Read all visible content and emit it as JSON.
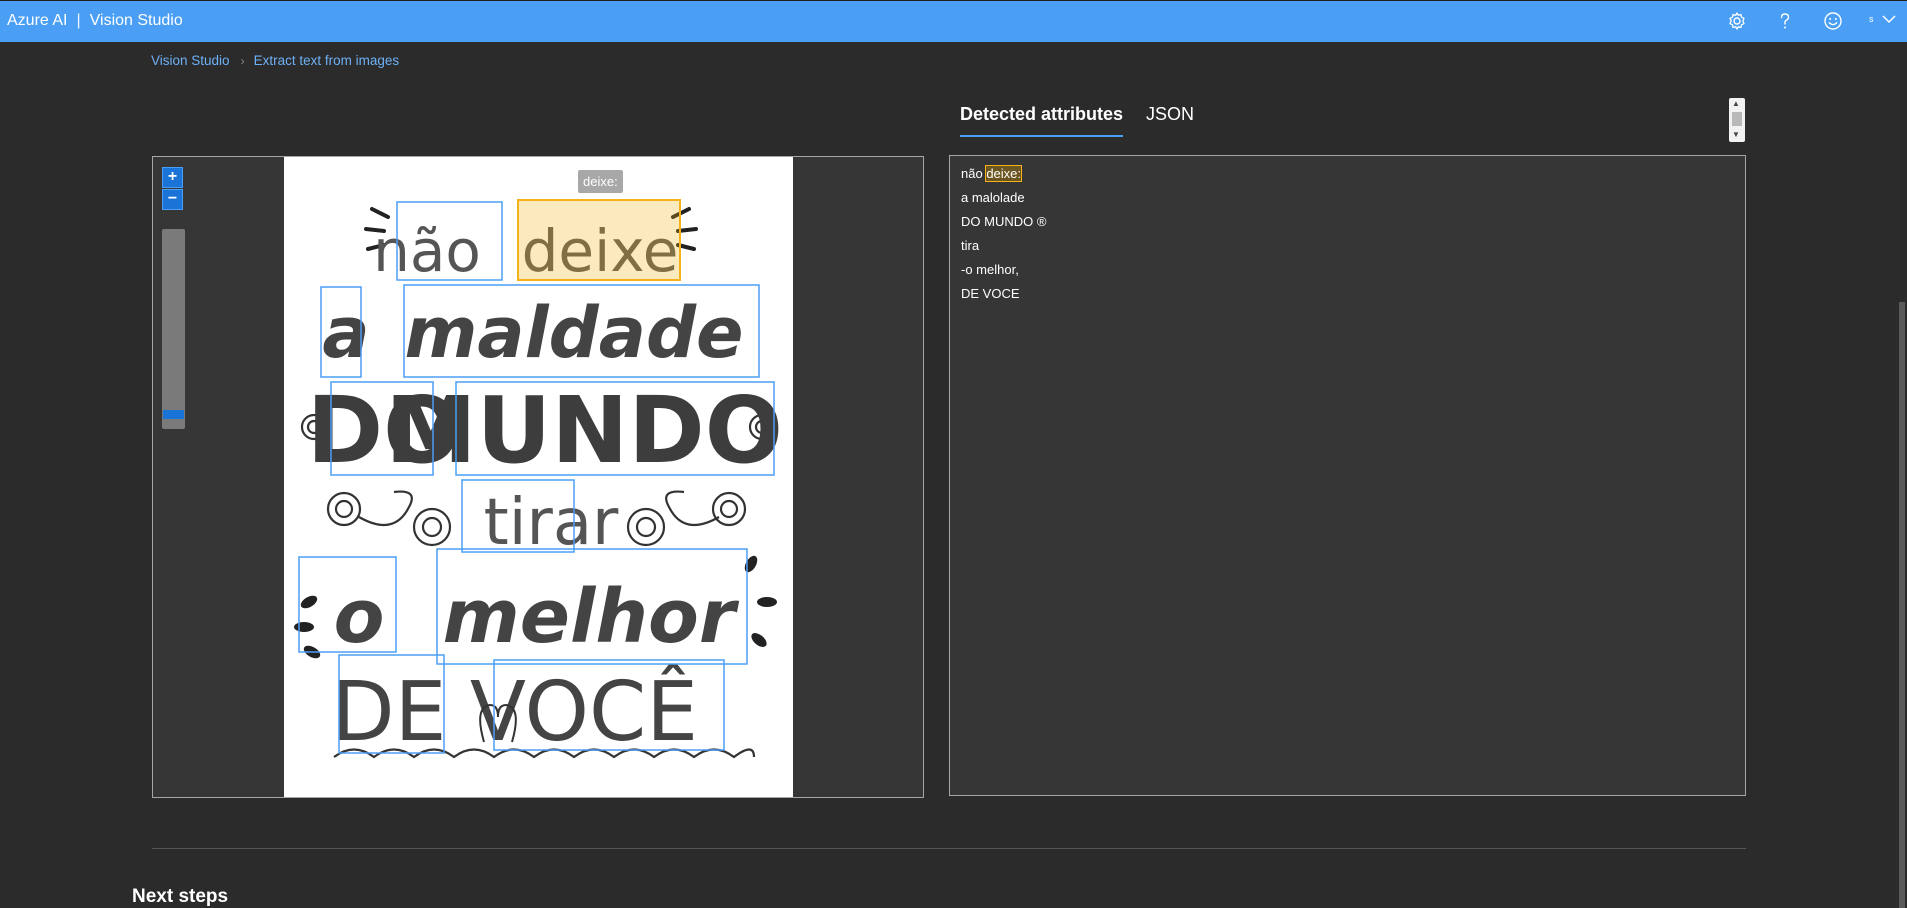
{
  "header": {
    "brand": "Azure AI",
    "separator": "|",
    "product": "Vision Studio",
    "icons": [
      "gear-icon",
      "help-icon",
      "feedback-smiley-icon",
      "account-icon",
      "chevron-down-icon"
    ],
    "account_initial": "s"
  },
  "breadcrumb": {
    "items": [
      "Vision Studio",
      "Extract text from images"
    ]
  },
  "viewer": {
    "zoom_in": "+",
    "zoom_out": "−",
    "zoom_level": 0.05,
    "tooltip": "deixe:",
    "image_words": [
      "não",
      "deixe",
      "a",
      "maldade",
      "DO",
      "MUNDO",
      "tirar",
      "o",
      "melhor",
      "DE",
      "VOCÊ"
    ]
  },
  "tabs": [
    {
      "label": "Detected attributes",
      "active": true
    },
    {
      "label": "JSON",
      "active": false
    }
  ],
  "results": {
    "lines": [
      {
        "prefix": "não ",
        "highlight": "deixe:"
      },
      {
        "text": "a malolade"
      },
      {
        "text": "DO MUNDO ®"
      },
      {
        "text": "tira"
      },
      {
        "text": "-o melhor,"
      },
      {
        "text": "DE VOCE"
      }
    ]
  },
  "next_steps": "Next steps",
  "colors": {
    "topbar": "#4a9ff5",
    "background": "#2b2b2b",
    "panel": "#363636",
    "word_box": "#4a9ff5",
    "highlight_box": "#f6b21a"
  }
}
